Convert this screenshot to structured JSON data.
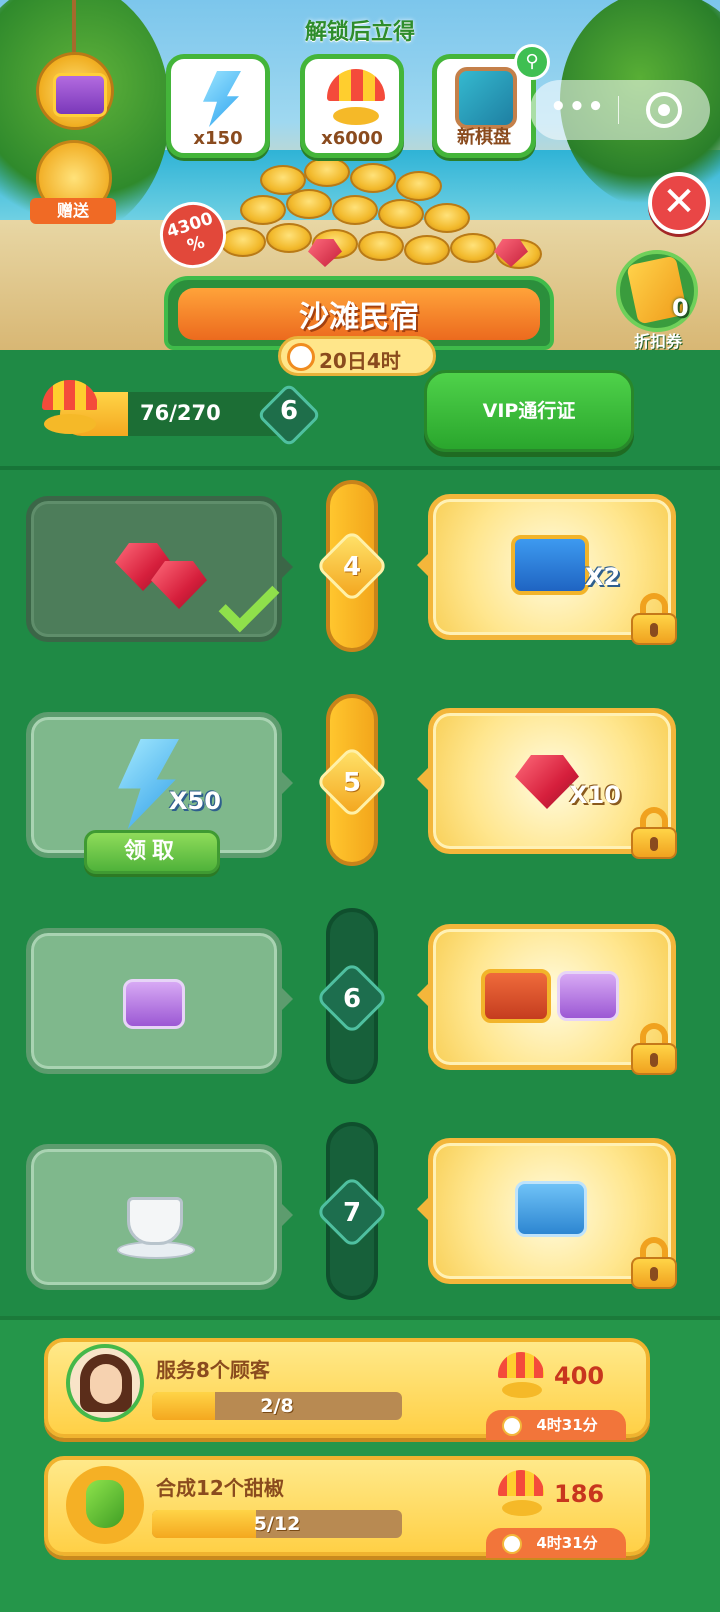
{
  "banner": {
    "unlock_title": "解锁后立得",
    "rewards": [
      {
        "icon": "energy-bolt-icon",
        "label": "x150"
      },
      {
        "icon": "beach-umbrella-icon",
        "label": "x6000"
      },
      {
        "icon": "new-board-icon",
        "label": "新棋盘"
      }
    ],
    "gift_label": "赠送",
    "discount_badge": "4300\n%",
    "coupon_count": "0",
    "coupon_label": "折扣券",
    "close_symbol": "✕",
    "capsule_dots": "•••"
  },
  "event": {
    "title": "沙滩民宿",
    "timer": "20日4时"
  },
  "progress": {
    "text": "76/270",
    "current": 76,
    "total": 270,
    "level": "6"
  },
  "vip_button": {
    "label": "VIP通行证"
  },
  "tiers": [
    {
      "level": "4",
      "track_filled": true,
      "free_reward": {
        "icon": "gems-icon",
        "qty": "",
        "claimed": true
      },
      "vip_reward": {
        "icon": "blue-chest-icon",
        "qty": "X2",
        "locked": true
      }
    },
    {
      "level": "5",
      "track_filled": true,
      "free_reward": {
        "icon": "energy-bolt-icon",
        "qty": "X50",
        "claimable": true,
        "claim_label": "领取"
      },
      "vip_reward": {
        "icon": "ruby-gem-icon",
        "qty": "X10",
        "locked": true
      }
    },
    {
      "level": "6",
      "track_filled": false,
      "free_reward": {
        "icon": "purple-chest-icon",
        "qty": ""
      },
      "vip_reward": {
        "icon": "red-and-purple-chests-icon",
        "qty": "",
        "locked": true
      }
    },
    {
      "level": "7",
      "track_filled": false,
      "free_reward": {
        "icon": "tea-cup-icon",
        "qty": ""
      },
      "vip_reward": {
        "icon": "cyan-chest-icon",
        "qty": "",
        "locked": true
      }
    }
  ],
  "tasks": [
    {
      "title": "服务8个顾客",
      "progress_text": "2/8",
      "current": 2,
      "total": 8,
      "reward": "400",
      "time_left": "4时31分",
      "icon": "customer-avatar-icon"
    },
    {
      "title": "合成12个甜椒",
      "progress_text": "5/12",
      "current": 5,
      "total": 12,
      "reward": "186",
      "time_left": "4时31分",
      "icon": "green-pepper-icon"
    }
  ],
  "colors": {
    "background": "#1f8a45",
    "accent_orange": "#ec6a1e",
    "gold": "#ffd447",
    "vip_green": "#2aa62d"
  }
}
